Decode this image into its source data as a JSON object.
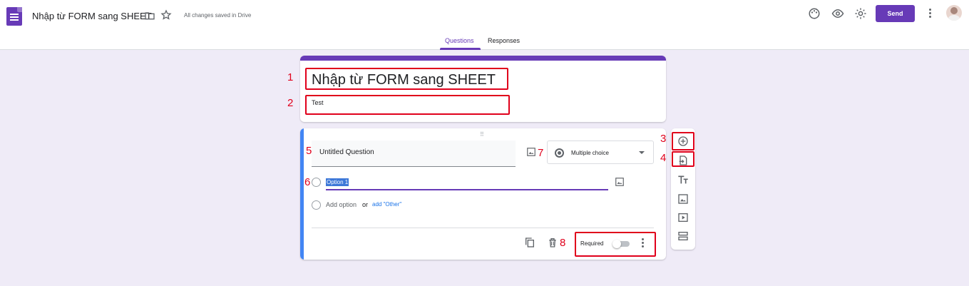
{
  "app": {
    "doc_title": "Nhập từ FORM sang SHEET",
    "save_status": "All changes saved in Drive",
    "send_label": "Send",
    "icons": [
      "forms-logo-icon",
      "folder-icon",
      "star-icon",
      "palette-icon",
      "eye-icon",
      "gear-icon",
      "more-vert-icon",
      "avatar"
    ]
  },
  "tabs": [
    {
      "label": "Questions",
      "active": true
    },
    {
      "label": "Responses",
      "active": false
    }
  ],
  "form": {
    "title": "Nhập từ FORM sang SHEET",
    "description": "Test"
  },
  "question": {
    "title": "Untitled Question",
    "type": "Multiple choice",
    "options": [
      "Option 1"
    ],
    "add_option_label": "Add option",
    "or_label": "or",
    "add_other_label": "add \"Other\"",
    "required_label": "Required",
    "required_on": false
  },
  "annotations": [
    "1",
    "2",
    "3",
    "4",
    "5",
    "6",
    "7",
    "8"
  ],
  "colors": {
    "accent": "#673ab7",
    "highlight": "#e0001b",
    "focus_bar": "#4285f4",
    "background": "#efebf7"
  }
}
